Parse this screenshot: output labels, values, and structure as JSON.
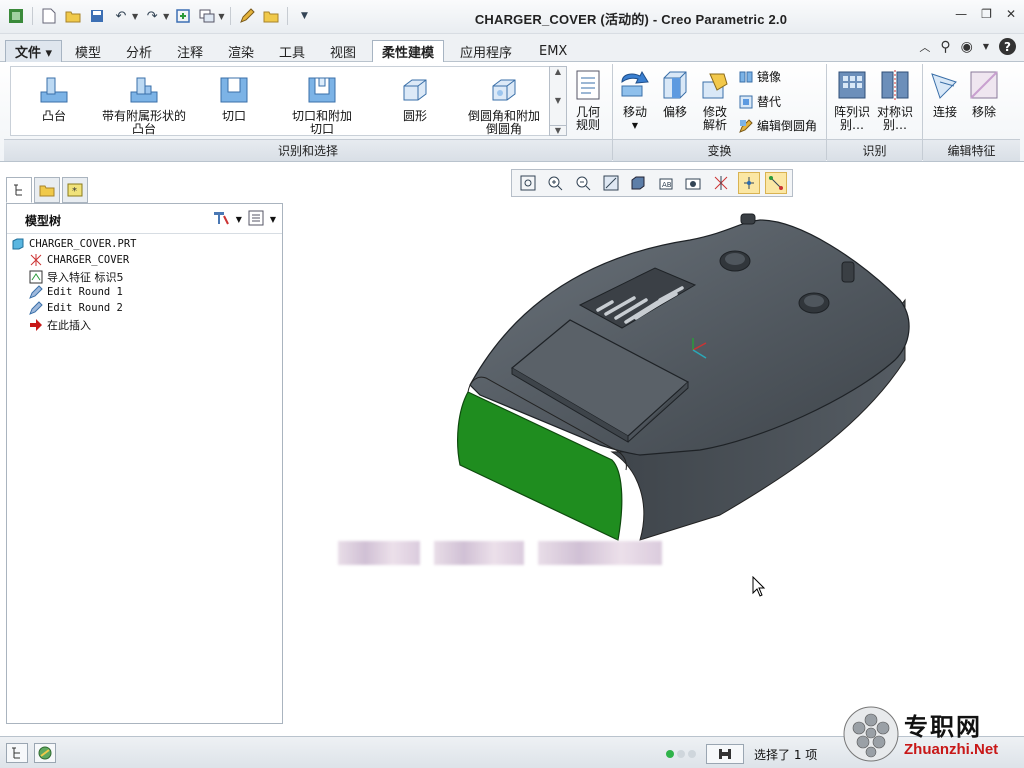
{
  "window": {
    "title": "CHARGER_COVER (活动的) - Creo Parametric 2.0"
  },
  "tabs": [
    {
      "label": "文件 ▾"
    },
    {
      "label": "模型"
    },
    {
      "label": "分析"
    },
    {
      "label": "注释"
    },
    {
      "label": "渲染"
    },
    {
      "label": "工具"
    },
    {
      "label": "视图"
    },
    {
      "label": "柔性建模"
    },
    {
      "label": "应用程序"
    },
    {
      "label": "EMX"
    }
  ],
  "active_tab": "柔性建模",
  "ribbon": {
    "recognize_group": {
      "label": "识别和选择",
      "gallery": [
        {
          "label": "凸台"
        },
        {
          "label": "带有附属形状的凸台"
        },
        {
          "label": "切口"
        },
        {
          "label": "切口和附加切口"
        },
        {
          "label": "圆形"
        },
        {
          "label": "倒圆角和附加倒圆角"
        }
      ],
      "geometry_rule": "几何规则"
    },
    "transform_group": {
      "label": "变换",
      "move": "移动",
      "offset": "偏移",
      "modify_analysis": "修改解析",
      "mirror": "镜像",
      "substitute": "替代",
      "edit_round": "编辑倒圆角"
    },
    "identify_group": {
      "label": "识别",
      "pattern_recognition": "阵列识别…",
      "symmetry_recognition": "对称识别…"
    },
    "edit_feature_group": {
      "label": "编辑特征",
      "attach": "连接",
      "remove": "移除"
    }
  },
  "model_tree": {
    "title": "模型树",
    "items": [
      {
        "label": "CHARGER_COVER.PRT",
        "icon": "part-icon"
      },
      {
        "label": "CHARGER_COVER",
        "icon": "csys-icon"
      },
      {
        "label": "导入特征 标识5",
        "icon": "import-feature-icon"
      },
      {
        "label": "Edit Round 1",
        "icon": "edit-round-icon"
      },
      {
        "label": "Edit Round 2",
        "icon": "edit-round-icon"
      },
      {
        "label": "在此插入",
        "icon": "insert-here-arrow-icon"
      }
    ]
  },
  "status": {
    "selection": "选择了 1 项"
  },
  "watermark": {
    "text": "专职网",
    "url": "Zhuanzhi.Net"
  },
  "colors": {
    "ribbon_bg": "#f1f4f7",
    "model_body": "#4a5158",
    "selected_face": "#1e8a1e",
    "accent": "#2b6cb0"
  }
}
